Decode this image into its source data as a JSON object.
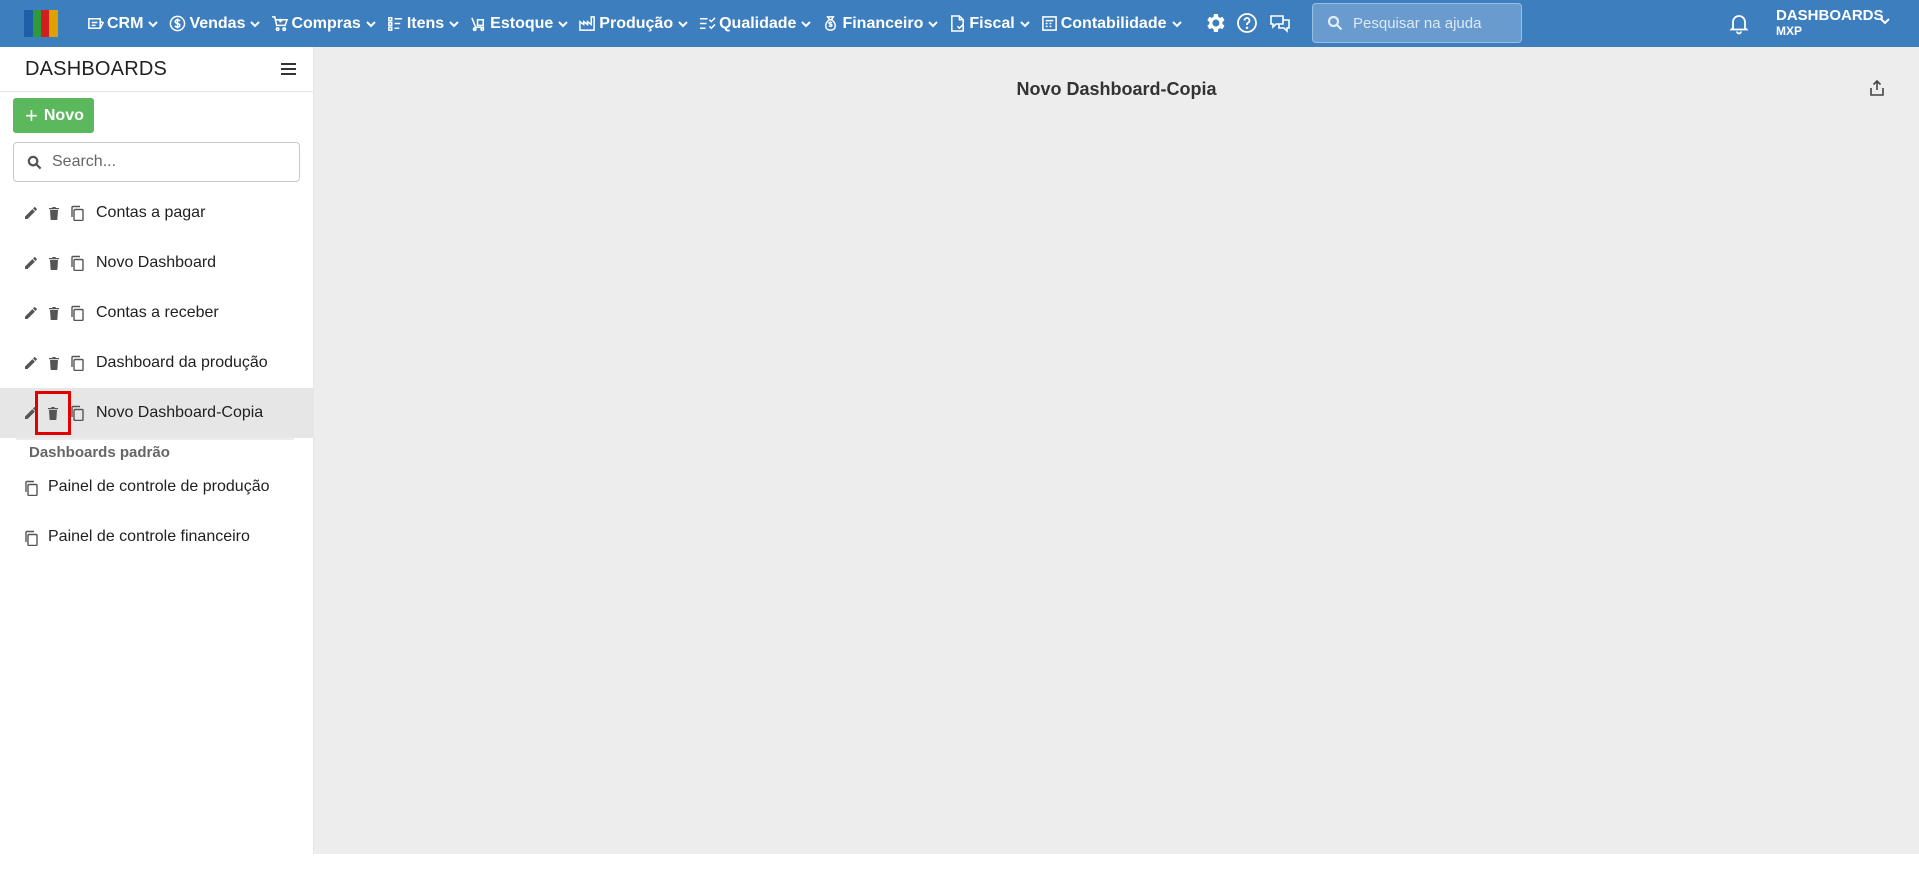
{
  "nav": {
    "items": [
      {
        "label": "CRM",
        "icon": "crm-icon"
      },
      {
        "label": "Vendas",
        "icon": "dollar-coin-icon"
      },
      {
        "label": "Compras",
        "icon": "cart-icon"
      },
      {
        "label": "Itens",
        "icon": "items-grid-icon"
      },
      {
        "label": "Estoque",
        "icon": "forklift-icon"
      },
      {
        "label": "Produção",
        "icon": "factory-icon"
      },
      {
        "label": "Qualidade",
        "icon": "checklist-icon"
      },
      {
        "label": "Financeiro",
        "icon": "money-bag-icon"
      },
      {
        "label": "Fiscal",
        "icon": "document-icon"
      },
      {
        "label": "Contabilidade",
        "icon": "calculator-icon"
      }
    ],
    "search_placeholder": "Pesquisar na ajuda",
    "user": {
      "title": "DASHBOARDS",
      "subtitle": "MXP"
    }
  },
  "sidebar": {
    "title": "DASHBOARDS",
    "new_button": "Novo",
    "search_placeholder": "Search...",
    "dashboards": [
      {
        "label": "Contas a pagar"
      },
      {
        "label": "Novo Dashboard"
      },
      {
        "label": "Contas a receber"
      },
      {
        "label": "Dashboard da produção"
      },
      {
        "label": "Novo Dashboard-Copia"
      }
    ],
    "section_title": "Dashboards padrão",
    "default_dashboards": [
      {
        "label": "Painel de controle de produção"
      },
      {
        "label": "Painel de controle financeiro"
      }
    ]
  },
  "main": {
    "title": "Novo Dashboard-Copia"
  },
  "colors": {
    "topbar": "#3d7ebf",
    "new_button": "#5cb85c",
    "highlight": "#e00000",
    "main_bg": "#ededed"
  }
}
